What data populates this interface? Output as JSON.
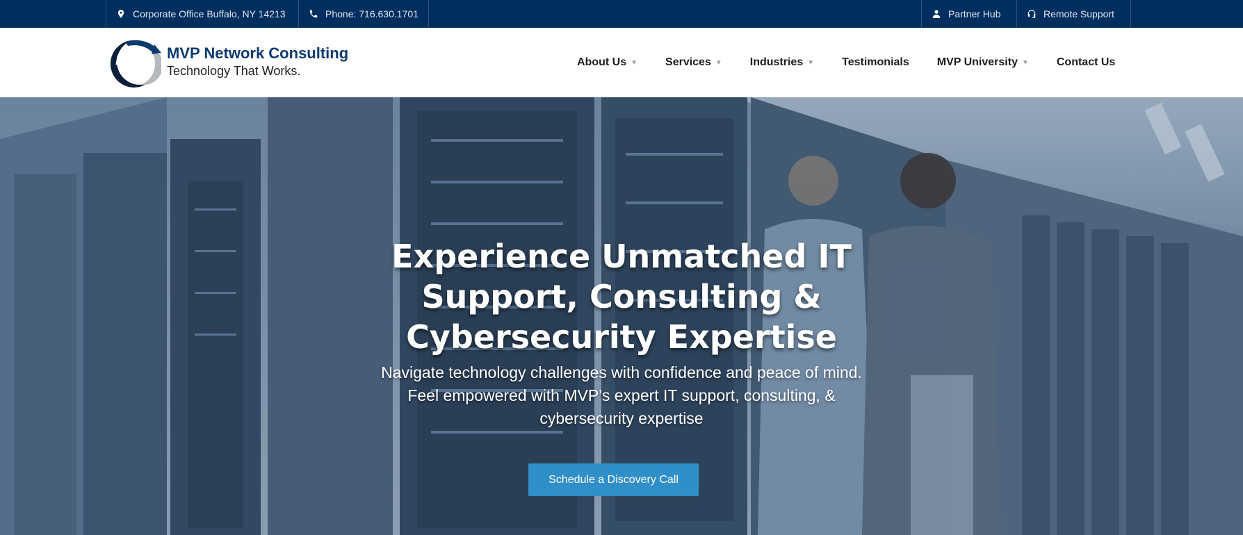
{
  "topbar": {
    "address": "Corporate Office Buffalo, NY 14213",
    "phone": "Phone: 716.630.1701",
    "partner_hub": "Partner Hub",
    "remote_support": "Remote Support"
  },
  "header": {
    "logo_mark_text": "MVP",
    "logo_name": "MVP Network Consulting",
    "logo_tagline": "Technology That Works."
  },
  "nav": {
    "items": [
      {
        "label": "About Us",
        "has_dropdown": true
      },
      {
        "label": "Services",
        "has_dropdown": true
      },
      {
        "label": "Industries",
        "has_dropdown": true
      },
      {
        "label": "Testimonials",
        "has_dropdown": false
      },
      {
        "label": "MVP University",
        "has_dropdown": true
      },
      {
        "label": "Contact Us",
        "has_dropdown": false
      }
    ],
    "dropdown_icon": "caret-down-icon"
  },
  "hero": {
    "title_lines": [
      "Experience Unmatched IT",
      "Support, Consulting &",
      "Cybersecurity Expertise"
    ],
    "subtitle_lines": [
      "Navigate technology challenges with confidence and peace of mind.",
      "Feel empowered with MVP’s expert IT support, consulting, &",
      "cybersecurity expertise"
    ],
    "cta_label": "Schedule a Discovery Call"
  },
  "colors": {
    "topbar_bg": "#002f5f",
    "brand_navy": "#0d3a6e",
    "cta_blue": "#2f8fc9",
    "hero_overlay": "#6d8299"
  },
  "icons": {
    "address": "map-pin-icon",
    "phone": "phone-icon",
    "partner_hub": "user-icon",
    "remote_support": "headset-icon"
  }
}
